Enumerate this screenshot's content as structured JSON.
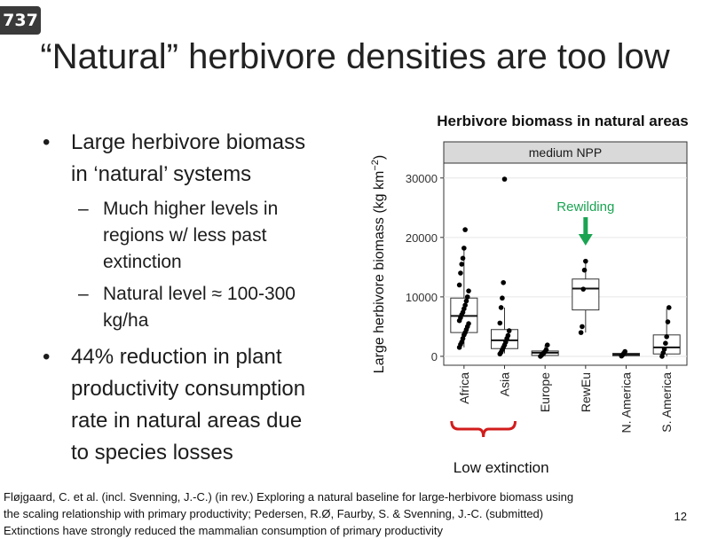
{
  "slide_badge": "737",
  "title": "“Natural” herbivore densities are too low",
  "bullets": {
    "b1": [
      "Large herbivore biomass",
      "in ‘natural’ systems"
    ],
    "b1_subs": [
      [
        "Much higher levels in",
        "regions w/ less past",
        "extinction"
      ],
      [
        "Natural level ≈ 100-300",
        "kg/ha"
      ]
    ],
    "b2": [
      "44% reduction in plant",
      "productivity consumption",
      "rate in natural areas due",
      "to species losses"
    ]
  },
  "references": [
    "Fløjgaard, C. et al. (incl. Svenning, J.-C.) (in rev.) Exploring a natural baseline for large-herbivore biomass using",
    "the scaling relationship with primary productivity; Pedersen, R.Ø, Faurby, S. & Svenning, J.-C. (submitted)",
    "Extinctions have strongly reduced the mammalian consumption of primary productivity"
  ],
  "page_number": "12",
  "chart_data": {
    "type": "boxplot",
    "title": "Herbivore biomass in natural areas",
    "panel_label": "medium NPP",
    "ylabel": "Large herbivore biomass (kg km",
    "ylabel_sup": "−2",
    "ylabel_close": ")",
    "ylim": [
      -1500,
      32500
    ],
    "yticks": [
      0,
      10000,
      20000,
      30000
    ],
    "ytick_labels": [
      "0",
      "10000",
      "20000",
      "30000"
    ],
    "categories": [
      "Africa",
      "Asia",
      "Europe",
      "RewEu",
      "N. America",
      "S. America"
    ],
    "boxes": [
      {
        "q1": 4000,
        "median": 6800,
        "q3": 9800,
        "wlo": 1500,
        "whi": 18000
      },
      {
        "q1": 1300,
        "median": 2700,
        "q3": 4500,
        "wlo": 500,
        "whi": 8200
      },
      {
        "q1": 150,
        "median": 600,
        "q3": 900,
        "wlo": 0,
        "whi": 1900
      },
      {
        "q1": 7800,
        "median": 11400,
        "q3": 13000,
        "wlo": 4000,
        "whi": 16000
      },
      {
        "q1": 100,
        "median": 300,
        "q3": 500,
        "wlo": 0,
        "whi": 800
      },
      {
        "q1": 400,
        "median": 1500,
        "q3": 3600,
        "wlo": 0,
        "whi": 8000
      }
    ],
    "points": [
      [
        1500,
        2000,
        2400,
        3000,
        3600,
        4000,
        4500,
        5000,
        5500,
        6000,
        6500,
        7000,
        7400,
        8000,
        8600,
        9300,
        10000,
        11000,
        12000,
        14000,
        15500,
        16500,
        18200,
        21300
      ],
      [
        400,
        700,
        1100,
        1500,
        1900,
        2400,
        3000,
        3500,
        4300,
        5600,
        8200,
        9800,
        12400,
        29800
      ],
      [
        0,
        200,
        400,
        600,
        800,
        1100,
        1900
      ],
      [
        4000,
        5000,
        11300,
        14500,
        16000
      ],
      [
        50,
        250,
        500,
        800
      ],
      [
        0,
        600,
        1200,
        2200,
        3300,
        5800,
        8200
      ]
    ],
    "annotation": "Rewilding",
    "annotation_category": "RewEu",
    "annotation_color": "#1aa452",
    "bracket_label": "Low extinction",
    "bracket_color": "#d21c1c",
    "bracket_categories": [
      "Africa",
      "Asia"
    ]
  }
}
